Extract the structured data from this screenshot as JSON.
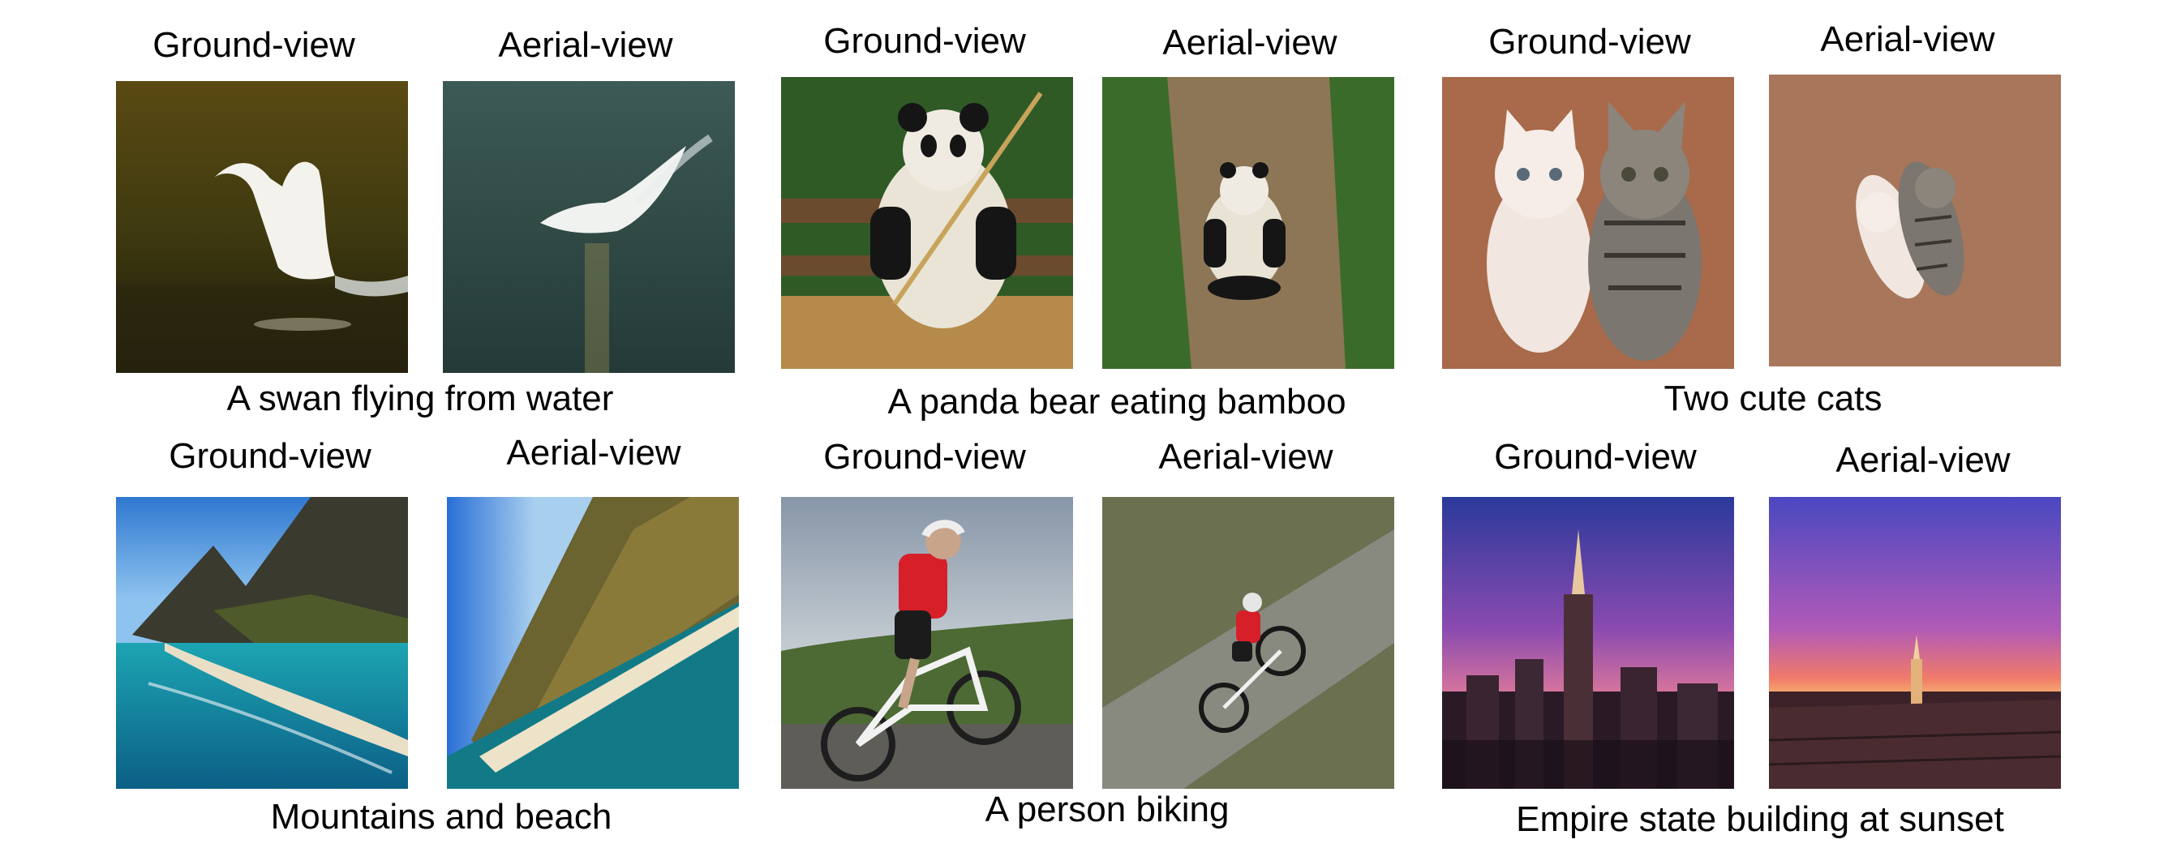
{
  "groups": [
    {
      "caption": "A swan flying from water",
      "ground_label": "Ground-view",
      "aerial_label": "Aerial-view",
      "ground_image": "swan-ground-photo",
      "aerial_image": "swan-aerial-photo"
    },
    {
      "caption": "A panda bear eating bamboo",
      "ground_label": "Ground-view",
      "aerial_label": "Aerial-view",
      "ground_image": "panda-ground-photo",
      "aerial_image": "panda-aerial-photo"
    },
    {
      "caption": "Two cute cats",
      "ground_label": "Ground-view",
      "aerial_label": "Aerial-view",
      "ground_image": "cats-ground-photo",
      "aerial_image": "cats-aerial-photo"
    },
    {
      "caption": "Mountains and beach",
      "ground_label": "Ground-view",
      "aerial_label": "Aerial-view",
      "ground_image": "mountains-ground-photo",
      "aerial_image": "mountains-aerial-photo"
    },
    {
      "caption": "A person biking",
      "ground_label": "Ground-view",
      "aerial_label": "Aerial-view",
      "ground_image": "biker-ground-photo",
      "aerial_image": "biker-aerial-photo"
    },
    {
      "caption": "Empire state building at sunset",
      "ground_label": "Ground-view",
      "aerial_label": "Aerial-view",
      "ground_image": "empire-ground-photo",
      "aerial_image": "empire-aerial-photo"
    }
  ]
}
